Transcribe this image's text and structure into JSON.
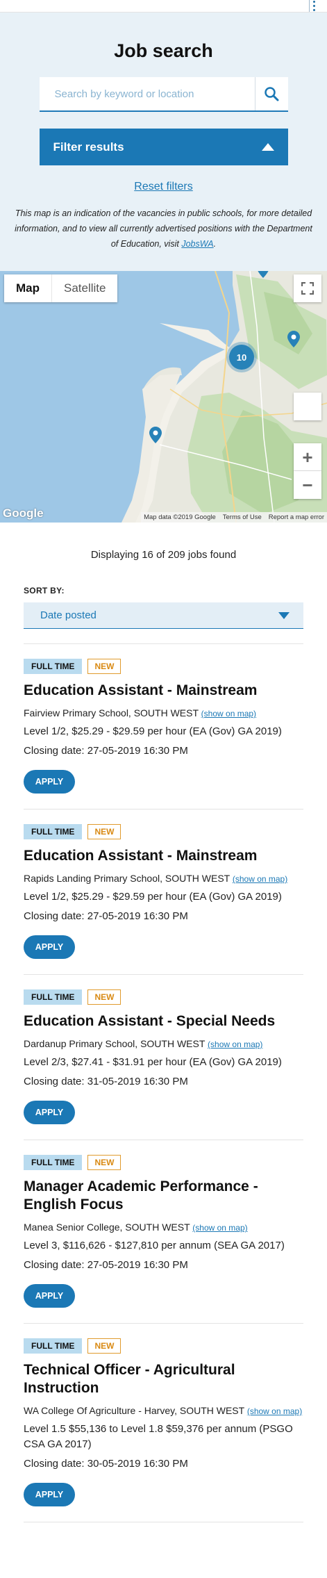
{
  "header": {
    "menu_icon": "more-vertical-icon"
  },
  "search": {
    "title": "Job search",
    "placeholder": "Search by keyword or location",
    "search_icon": "search-icon",
    "filter_label": "Filter results",
    "filter_icon": "chevron-up-icon",
    "reset_label": "Reset filters",
    "note_text": "This map is an indication of the vacancies in public schools, for more detailed information, and to view all currently advertised positions with the Department of Education, visit ",
    "note_link": "JobsWA",
    "note_end": "."
  },
  "map": {
    "type_map": "Map",
    "type_satellite": "Satellite",
    "cluster_count": "10",
    "google": "Google",
    "footer": {
      "data": "Map data ©2019 Google",
      "terms": "Terms of Use",
      "report": "Report a map error"
    },
    "zoom_in": "+",
    "zoom_out": "−"
  },
  "results": {
    "count_text": "Displaying 16 of 209 jobs found",
    "sort_label": "SORT BY:",
    "sort_value": "Date posted"
  },
  "jobs": [
    {
      "badge_type": "FULL TIME",
      "badge_new": "NEW",
      "title": "Education Assistant - Mainstream",
      "school": "Fairview Primary School, SOUTH WEST",
      "map_link": "(show on map)",
      "salary": "Level 1/2, $25.29 - $29.59 per hour (EA (Gov) GA 2019)",
      "closing": "Closing date: 27-05-2019 16:30 PM",
      "apply": "APPLY"
    },
    {
      "badge_type": "FULL TIME",
      "badge_new": "NEW",
      "title": "Education Assistant - Mainstream",
      "school": "Rapids Landing Primary School, SOUTH WEST",
      "map_link": "(show on map)",
      "salary": "Level 1/2, $25.29 - $29.59 per hour (EA (Gov) GA 2019)",
      "closing": "Closing date: 27-05-2019 16:30 PM",
      "apply": "APPLY"
    },
    {
      "badge_type": "FULL TIME",
      "badge_new": "NEW",
      "title": "Education Assistant - Special Needs",
      "school": "Dardanup Primary School, SOUTH WEST",
      "map_link": "(show on map)",
      "salary": "Level 2/3, $27.41 - $31.91 per hour (EA (Gov) GA 2019)",
      "closing": "Closing date: 31-05-2019 16:30 PM",
      "apply": "APPLY"
    },
    {
      "badge_type": "FULL TIME",
      "badge_new": "NEW",
      "title": "Manager Academic Performance - English Focus",
      "school": "Manea Senior College, SOUTH WEST",
      "map_link": "(show on map)",
      "salary": "Level 3, $116,626 - $127,810 per annum (SEA GA 2017)",
      "closing": "Closing date: 27-05-2019 16:30 PM",
      "apply": "APPLY"
    },
    {
      "badge_type": "FULL TIME",
      "badge_new": "NEW",
      "title": "Technical Officer - Agricultural Instruction",
      "school": "WA College Of Agriculture - Harvey, SOUTH WEST",
      "map_link": "(show on map)",
      "salary": "Level 1.5 $55,136 to Level 1.8 $59,376 per annum (PSGO CSA GA 2017)",
      "closing": "Closing date: 30-05-2019 16:30 PM",
      "apply": "APPLY"
    }
  ]
}
